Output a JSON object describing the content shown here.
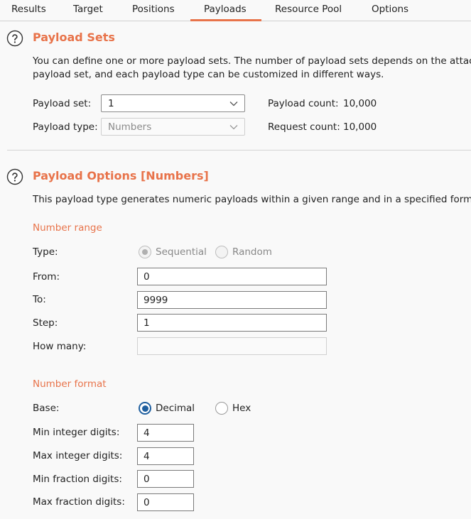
{
  "tabs": [
    {
      "label": "Results"
    },
    {
      "label": "Target"
    },
    {
      "label": "Positions"
    },
    {
      "label": "Payloads",
      "active": true
    },
    {
      "label": "Resource Pool"
    },
    {
      "label": "Options"
    }
  ],
  "payload_sets": {
    "title": "Payload Sets",
    "desc_line1": "You can define one or more payload sets. The number of payload sets depends on the attac",
    "desc_line2": "payload set, and each payload type can be customized in different ways.",
    "set_label": "Payload set:",
    "set_value": "1",
    "type_label": "Payload type:",
    "type_value": "Numbers",
    "count_label": "Payload count:",
    "count_value": "10,000",
    "request_label": "Request count:",
    "request_value": "10,000"
  },
  "payload_options": {
    "title": "Payload Options [Numbers]",
    "desc": "This payload type generates numeric payloads within a given range and in a specified forma",
    "range_heading": "Number range",
    "type_label": "Type:",
    "sequential_label": "Sequential",
    "random_label": "Random",
    "from_label": "From:",
    "from_value": "0",
    "to_label": "To:",
    "to_value": "9999",
    "step_label": "Step:",
    "step_value": "1",
    "howmany_label": "How many:",
    "howmany_value": "",
    "format_heading": "Number format",
    "base_label": "Base:",
    "decimal_label": "Decimal",
    "hex_label": "Hex",
    "min_int_label": "Min integer digits:",
    "min_int_value": "4",
    "max_int_label": "Max integer digits:",
    "max_int_value": "4",
    "min_frac_label": "Min fraction digits:",
    "min_frac_value": "0",
    "max_frac_label": "Max fraction digits:",
    "max_frac_value": "0"
  },
  "colors": {
    "accent": "#e8734a",
    "radio_selected": "#1f5f9f"
  },
  "icons": {
    "help": "help-circle-icon",
    "dropdown": "chevron-down-icon"
  }
}
